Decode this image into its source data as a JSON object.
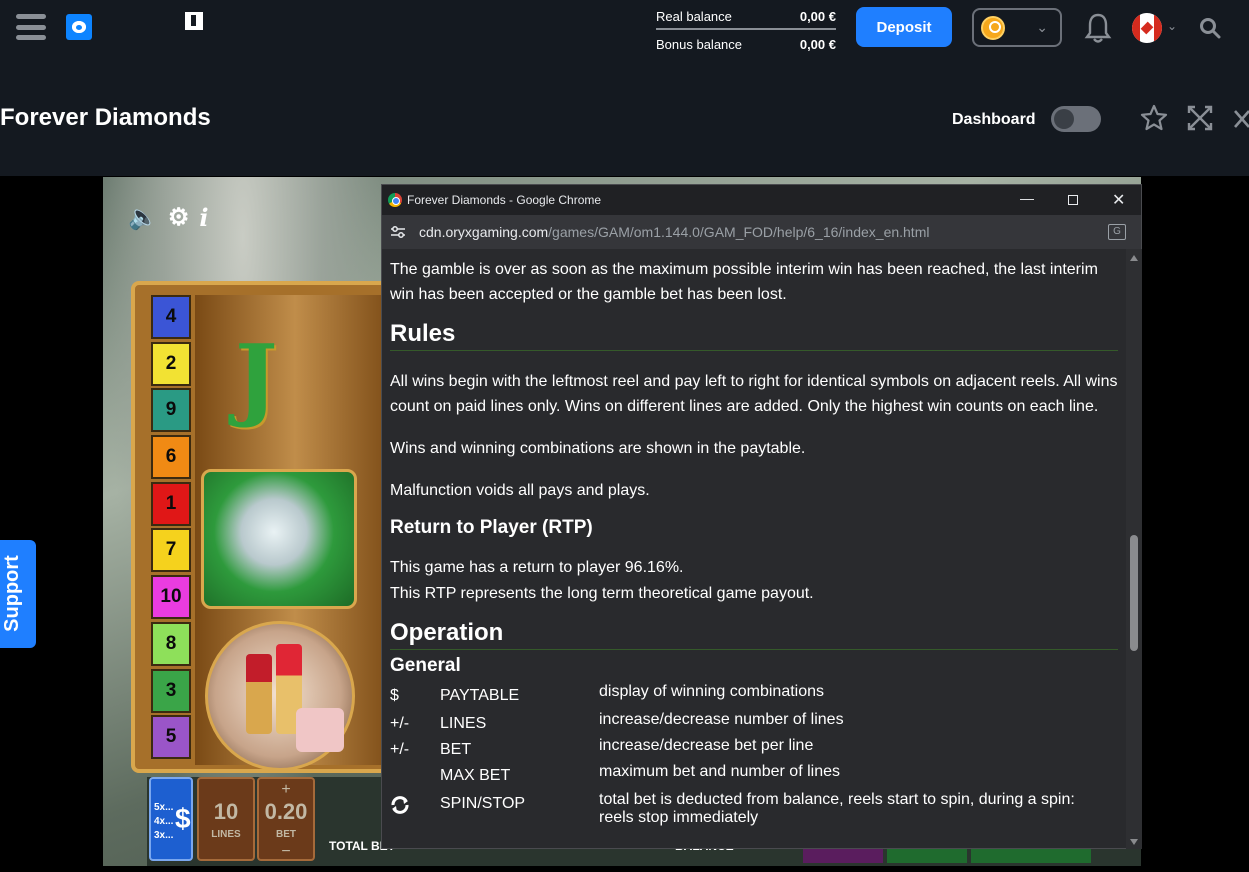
{
  "header": {
    "real_balance_label": "Real balance",
    "real_balance_value": "0,00 €",
    "bonus_balance_label": "Bonus balance",
    "bonus_balance_value": "0,00 €",
    "deposit_label": "Deposit",
    "account_chevron": "⌄",
    "flag_chevron": "⌄"
  },
  "titlebar": {
    "game_title": "Forever Diamonds",
    "dashboard_label": "Dashboard"
  },
  "support": {
    "label": "Support"
  },
  "game": {
    "line_numbers": [
      {
        "n": "4",
        "color": "#3b55d6"
      },
      {
        "n": "2",
        "color": "#f2e233"
      },
      {
        "n": "9",
        "color": "#2a9a84"
      },
      {
        "n": "6",
        "color": "#f08a14"
      },
      {
        "n": "1",
        "color": "#e01717"
      },
      {
        "n": "7",
        "color": "#f5d21d"
      },
      {
        "n": "10",
        "color": "#ea3ce0"
      },
      {
        "n": "8",
        "color": "#8ee05a"
      },
      {
        "n": "3",
        "color": "#3aa548"
      },
      {
        "n": "5",
        "color": "#9a55c8"
      }
    ],
    "reel_letter": "J",
    "paytable_multipliers": [
      "5x...",
      "4x...",
      "3x..."
    ],
    "paytable_symbol": "$",
    "lines_value": "10",
    "lines_label": "LINES",
    "bet_value": "0.20",
    "bet_label": "BET",
    "bet_plus": "+",
    "bet_minus": "−",
    "total_bet_label": "TOTAL BET",
    "balance_label": "BALANCE"
  },
  "popup": {
    "window_title": "Forever Diamonds - Google Chrome",
    "url_host": "cdn.oryxgaming.com",
    "url_path": "/games/GAM/om1.144.0/GAM_FOD/help/6_16/index_en.html",
    "minimize": "—",
    "close": "✕",
    "intro": "The gamble is over as soon as the maximum possible interim win has been reached, the last interim win has been accepted or the gamble bet has been lost.",
    "rules_heading": "Rules",
    "rules_p1": "All wins begin with the leftmost reel and pay left to right for identical symbols on adjacent reels. All wins count on paid lines only. Wins on different lines are added. Only the highest win counts on each line.",
    "rules_p2": "Wins and winning combinations are shown in the paytable.",
    "rules_p3": "Malfunction voids all pays and plays.",
    "rtp_heading": "Return to Player (RTP)",
    "rtp_p1": "This game has a return to player 96.16%.",
    "rtp_p2": "This RTP represents the long term theoretical game payout.",
    "operation_heading": "Operation",
    "general_heading": "General",
    "operations": [
      {
        "symbol": "$",
        "name": "PAYTABLE",
        "desc": "display of winning combinations"
      },
      {
        "symbol": "+/-",
        "name": "LINES",
        "desc": "increase/decrease number of lines"
      },
      {
        "symbol": "+/-",
        "name": "BET",
        "desc": "increase/decrease bet per line"
      },
      {
        "symbol": "",
        "name": "MAX BET",
        "desc": "maximum bet and number of lines"
      },
      {
        "symbol": "",
        "name": "SPIN/STOP",
        "desc": "total bet is deducted from balance, reels start to spin, during a spin: reels stop immediately"
      }
    ]
  }
}
